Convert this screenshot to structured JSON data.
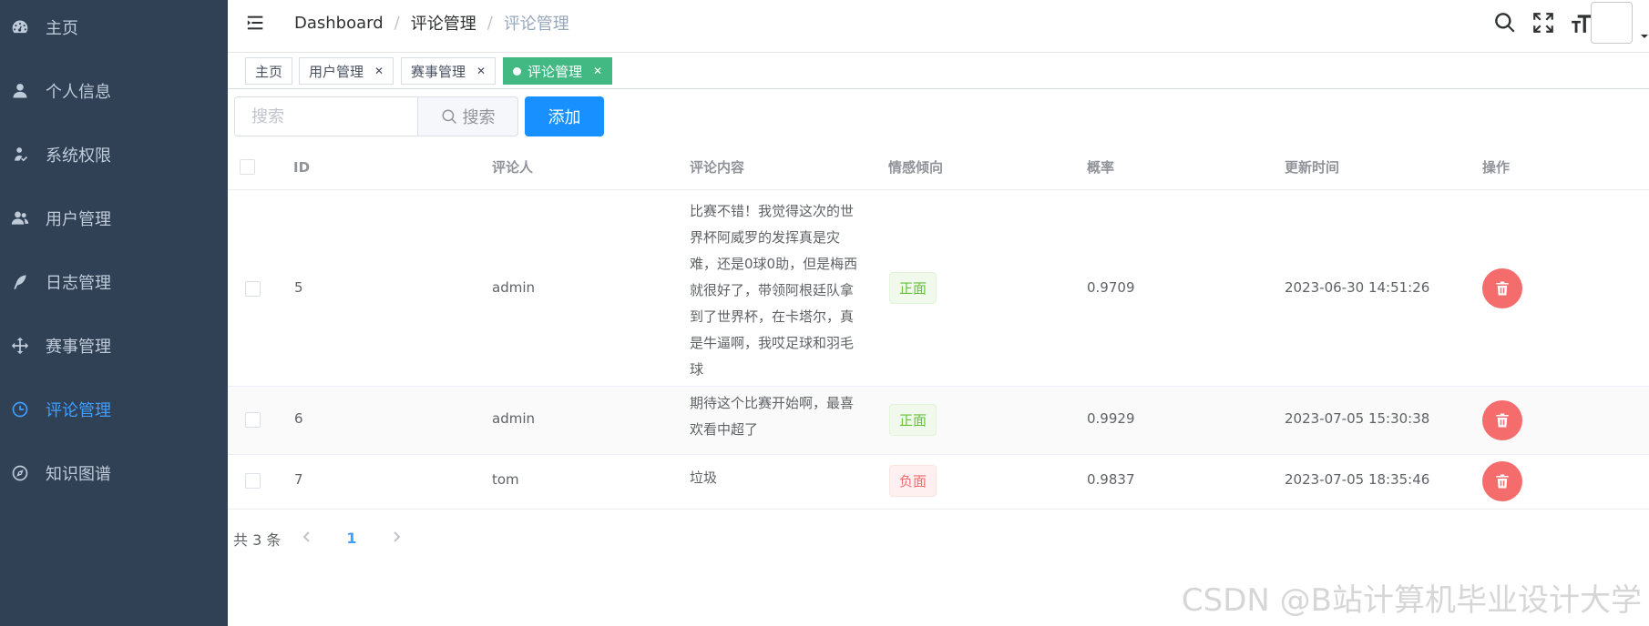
{
  "sidebar": {
    "items": [
      {
        "label": "主页",
        "icon": "dashboard-icon"
      },
      {
        "label": "个人信息",
        "icon": "user-icon"
      },
      {
        "label": "系统权限",
        "icon": "peoples-icon"
      },
      {
        "label": "用户管理",
        "icon": "users-icon"
      },
      {
        "label": "日志管理",
        "icon": "feather-icon"
      },
      {
        "label": "赛事管理",
        "icon": "move-icon"
      },
      {
        "label": "评论管理",
        "icon": "clock-icon",
        "active": true
      },
      {
        "label": "知识图谱",
        "icon": "compass-icon"
      }
    ]
  },
  "navbar": {
    "breadcrumb": [
      "Dashboard",
      "评论管理",
      "评论管理"
    ],
    "breadcrumb_sep": "/"
  },
  "tags": [
    {
      "label": "主页",
      "closable": false
    },
    {
      "label": "用户管理",
      "closable": true
    },
    {
      "label": "赛事管理",
      "closable": true
    },
    {
      "label": "评论管理",
      "closable": true,
      "active": true
    }
  ],
  "toolbar": {
    "search_placeholder": "搜索",
    "search_button": "搜索",
    "add_button": "添加"
  },
  "table": {
    "columns": [
      "ID",
      "评论人",
      "评论内容",
      "情感倾向",
      "概率",
      "更新时间",
      "操作"
    ],
    "rows": [
      {
        "id": "5",
        "author": "admin",
        "content": "比赛不错！我觉得这次的世界杯阿威罗的发挥真是灾难，还是0球0助，但是梅西就很好了，带领阿根廷队拿到了世界杯，在卡塔尔，真是牛逼啊，我哎足球和羽毛球",
        "sentiment": "正面",
        "sentiment_type": "positive",
        "probability": "0.9709",
        "updated": "2023-06-30 14:51:26"
      },
      {
        "id": "6",
        "author": "admin",
        "content": "期待这个比赛开始啊，最喜欢看中超了",
        "sentiment": "正面",
        "sentiment_type": "positive",
        "probability": "0.9929",
        "updated": "2023-07-05 15:30:38"
      },
      {
        "id": "7",
        "author": "tom",
        "content": "垃圾",
        "sentiment": "负面",
        "sentiment_type": "negative",
        "probability": "0.9837",
        "updated": "2023-07-05 18:35:46"
      }
    ]
  },
  "pagination": {
    "total_text": "共 3 条",
    "current_page": "1"
  },
  "watermark": "CSDN @B站计算机毕业设计大学",
  "colors": {
    "sidebar_bg": "#304156",
    "active_menu": "#409eff",
    "active_tag": "#42b983",
    "primary_button": "#1890ff",
    "danger": "#f56c6c",
    "success": "#67c23a"
  }
}
